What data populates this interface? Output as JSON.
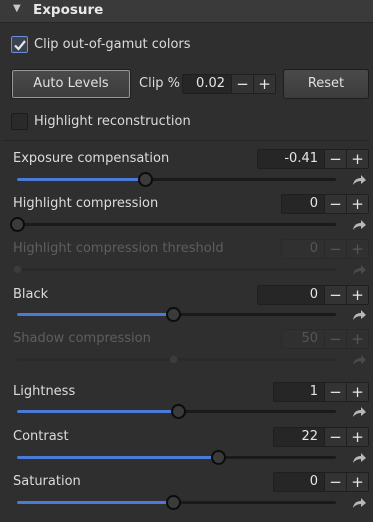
{
  "panel": {
    "title": "Exposure",
    "expand_icon": "triangle-down-icon"
  },
  "clip_out_of_gamut": {
    "label": "Clip out-of-gamut colors",
    "checked": true
  },
  "auto_levels": {
    "label": "Auto Levels"
  },
  "clip_percent": {
    "label": "Clip %",
    "value": "0.02"
  },
  "reset": {
    "label": "Reset"
  },
  "highlight_reconstruction": {
    "label": "Highlight reconstruction",
    "checked": false
  },
  "sliders": {
    "exposure_compensation": {
      "label": "Exposure compensation",
      "value": "-0.41",
      "level": 0.4,
      "enabled": true
    },
    "highlight_compression": {
      "label": "Highlight compression",
      "value": "0",
      "level": 0.0,
      "enabled": true
    },
    "highlight_compression_threshold": {
      "label": "Highlight compression threshold",
      "value": "0",
      "level": 0.0,
      "enabled": false
    },
    "black": {
      "label": "Black",
      "value": "0",
      "level": 0.49,
      "enabled": true
    },
    "shadow_compression": {
      "label": "Shadow compression",
      "value": "50",
      "level": 0.49,
      "enabled": false
    },
    "lightness": {
      "label": "Lightness",
      "value": "1",
      "level": 0.505,
      "enabled": true
    },
    "contrast": {
      "label": "Contrast",
      "value": "22",
      "level": 0.63,
      "enabled": true
    },
    "saturation": {
      "label": "Saturation",
      "value": "0",
      "level": 0.49,
      "enabled": true
    }
  },
  "spin_symbols": {
    "minus": "−",
    "plus": "+"
  },
  "colors": {
    "accent": "#4a7bd8",
    "background": "#2f2f2f",
    "header": "#3a3a3a"
  }
}
